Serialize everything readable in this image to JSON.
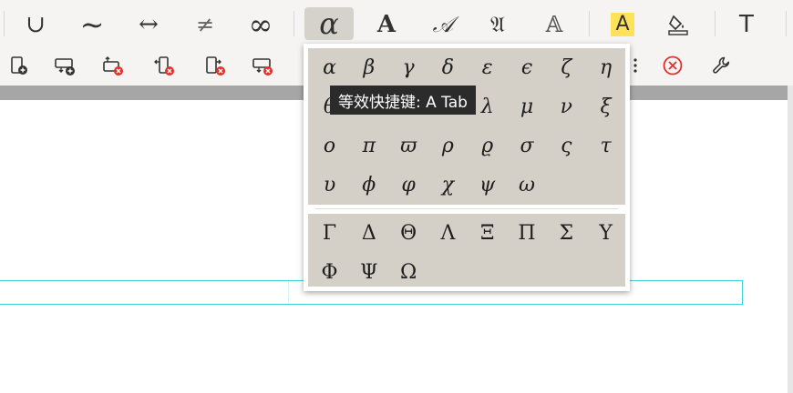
{
  "toolbar": {
    "row1": [
      {
        "name": "union-button",
        "glyph": "∪"
      },
      {
        "name": "tilde-button",
        "glyph": "∼"
      },
      {
        "name": "left-right-arrow-button",
        "glyph": "↔"
      },
      {
        "name": "not-equal-button",
        "glyph": "≠"
      },
      {
        "name": "infinity-button",
        "glyph": "∞"
      },
      {
        "name": "greek-letters-button",
        "glyph": "α"
      },
      {
        "name": "bold-font-button",
        "glyph": "A"
      },
      {
        "name": "script-font-button",
        "glyph": "𝒜"
      },
      {
        "name": "fraktur-font-button",
        "glyph": "𝔄"
      },
      {
        "name": "double-struck-font-button",
        "glyph": "𝔸"
      },
      {
        "name": "highlight-color-button",
        "glyph": "A"
      },
      {
        "name": "fill-color-button",
        "glyph": ""
      },
      {
        "name": "text-button",
        "glyph": "T"
      }
    ],
    "highlight_color": "#ffe15a",
    "delete_color": "#e0312a"
  },
  "tooltip": {
    "text": "等效快捷键: A  Tab"
  },
  "greek_lower": [
    "α",
    "β",
    "γ",
    "δ",
    "ε",
    "ϵ",
    "ζ",
    "η",
    "θ",
    "ϑ",
    "ι",
    "κ",
    "λ",
    "μ",
    "ν",
    "ξ",
    "ο",
    "π",
    "ϖ",
    "ρ",
    "ϱ",
    "σ",
    "ς",
    "τ",
    "υ",
    "ϕ",
    "φ",
    "χ",
    "ψ",
    "ω"
  ],
  "greek_upper": [
    "Γ",
    "Δ",
    "Θ",
    "Λ",
    "Ξ",
    "Π",
    "Σ",
    "Υ",
    "Φ",
    "Ψ",
    "Ω"
  ]
}
